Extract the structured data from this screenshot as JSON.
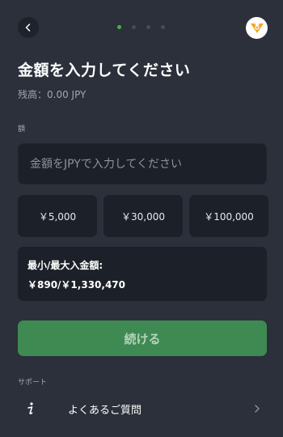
{
  "header": {
    "back_icon": "chevron-left-icon",
    "progress": {
      "total_steps": 4,
      "current_step": 1
    },
    "logo_icon": "brand-logo-icon"
  },
  "page": {
    "title": "金額を入力してください",
    "balance": "残高：0.00 JPY"
  },
  "amount": {
    "label": "額",
    "placeholder": "金額をJPYで入力してください",
    "value": ""
  },
  "presets": [
    "￥5,000",
    "￥30,000",
    "￥100,000"
  ],
  "limits": {
    "label": "最小/最大入金額:",
    "value": "￥890/￥1,330,470"
  },
  "continue_button": {
    "label": "続ける"
  },
  "support": {
    "label": "サポート",
    "faq": {
      "label": "よくあるご質問",
      "icon": "info-icon"
    }
  },
  "colors": {
    "background": "#2b303a",
    "card": "#1c2028",
    "accent": "#4caf50",
    "button": "#3f8a52",
    "muted_text": "#a1a6b0"
  }
}
